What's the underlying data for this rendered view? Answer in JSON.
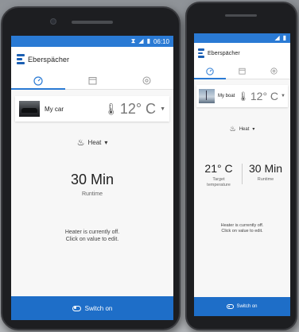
{
  "front": {
    "status": {
      "time": "06:10",
      "icons": [
        "vibrate-icon",
        "signal-icon",
        "battery-icon"
      ]
    },
    "brand": "Eberspächer",
    "tabs": [
      {
        "icon": "speedometer-icon",
        "active": true
      },
      {
        "icon": "calendar-icon",
        "active": false
      },
      {
        "icon": "settings-icon",
        "active": false
      }
    ],
    "device": {
      "name": "My car",
      "temperature": "12° C"
    },
    "mode": {
      "label": "Heat"
    },
    "runtime": {
      "value": "30 Min",
      "label": "Runtime"
    },
    "info": {
      "line1": "Heater is currently off.",
      "line2": "Click on value to edit."
    },
    "switch_label": "Switch on"
  },
  "back": {
    "brand": "Eberspächer",
    "device": {
      "name": "My boat",
      "temperature": "12° C"
    },
    "mode": {
      "label": "Heat"
    },
    "target": {
      "value": "21° C",
      "label_line1": "Target",
      "label_line2": "temperature"
    },
    "runtime": {
      "value": "30 Min",
      "label": "Runtime"
    },
    "info": {
      "line1": "Heater is currently off.",
      "line2": "Click on value to edit."
    },
    "switch_label": "Switch on"
  },
  "colors": {
    "accent": "#2a7ad4",
    "switch_bar": "#1e6ec8",
    "brand_blue": "#1b5fb3"
  }
}
